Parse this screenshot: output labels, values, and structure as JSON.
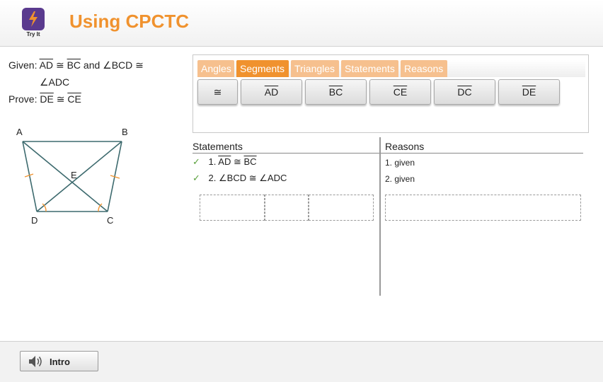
{
  "header": {
    "title": "Using CPCTC",
    "logo_caption": "Try It",
    "logo_icon": "lightning-icon",
    "accent_color": "#f0922e",
    "logo_color": "#5a3a8e"
  },
  "given": {
    "line1": {
      "label": "Given:",
      "seg1": "AD",
      "cong": "≅",
      "seg2": "BC",
      "and": "and",
      "ang1": "∠BCD",
      "cong2": "≅"
    },
    "line2": {
      "ang2": "∠ADC"
    },
    "prove": {
      "label": "Prove:",
      "seg1": "DE",
      "cong": "≅",
      "seg2": "CE"
    }
  },
  "figure": {
    "labels": {
      "A": "A",
      "B": "B",
      "C": "C",
      "D": "D",
      "E": "E"
    }
  },
  "tabs": [
    {
      "label": "Angles",
      "active": false
    },
    {
      "label": "Segments",
      "active": true
    },
    {
      "label": "Triangles",
      "active": false
    },
    {
      "label": "Statements",
      "active": false
    },
    {
      "label": "Reasons",
      "active": false
    }
  ],
  "tiles": [
    {
      "label": "≅",
      "overline": false
    },
    {
      "label": "AD",
      "overline": true
    },
    {
      "label": "BC",
      "overline": true
    },
    {
      "label": "CE",
      "overline": true
    },
    {
      "label": "DC",
      "overline": true
    },
    {
      "label": "DE",
      "overline": true
    }
  ],
  "proof": {
    "statements_header": "Statements",
    "reasons_header": "Reasons",
    "rows": [
      {
        "check": "✓",
        "num": "1.",
        "a": "AD",
        "cong": "≅",
        "b": "BC",
        "reason": "1. given"
      },
      {
        "check": "✓",
        "num": "2.",
        "a": "∠BCD",
        "cong": "≅",
        "b": "∠ADC",
        "reason": "2. given"
      }
    ]
  },
  "footer": {
    "intro_label": "Intro",
    "intro_icon": "speaker-icon"
  }
}
